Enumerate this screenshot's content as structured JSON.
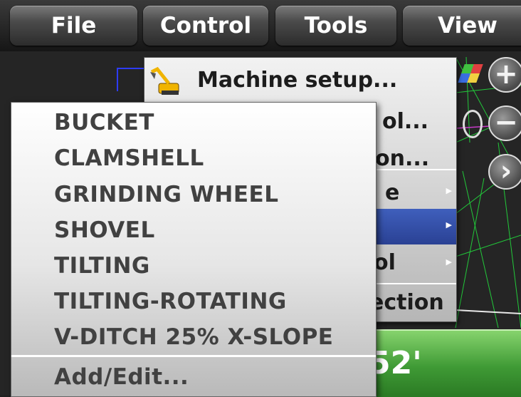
{
  "menubar": {
    "items": [
      {
        "label": "File"
      },
      {
        "label": "Control"
      },
      {
        "label": "Tools"
      },
      {
        "label": "View"
      }
    ]
  },
  "control_menu": {
    "machine_setup_label": "Machine setup...",
    "partial_items": [
      "ol...",
      "on...",
      "e",
      "",
      "ol",
      "ection"
    ]
  },
  "tool_submenu": {
    "items": [
      "BUCKET",
      "CLAMSHELL",
      "GRINDING WHEEL",
      "SHOVEL",
      "TILTING",
      "TILTING-ROTATING",
      "V-DITCH 25% X-SLOPE"
    ],
    "add_edit_label": "Add/Edit..."
  },
  "status": {
    "partial_value": "52'",
    "color": "#4fae40"
  },
  "side_buttons": {
    "icons": [
      "zoom-in-icon",
      "zoom-out-icon",
      "chevron-right-icon",
      "map-icon",
      "machine-view-icon"
    ]
  },
  "colors": {
    "highlight": "#2e4aa6",
    "menu_bg": "#d9d9d9",
    "status_green": "#4fae40"
  }
}
